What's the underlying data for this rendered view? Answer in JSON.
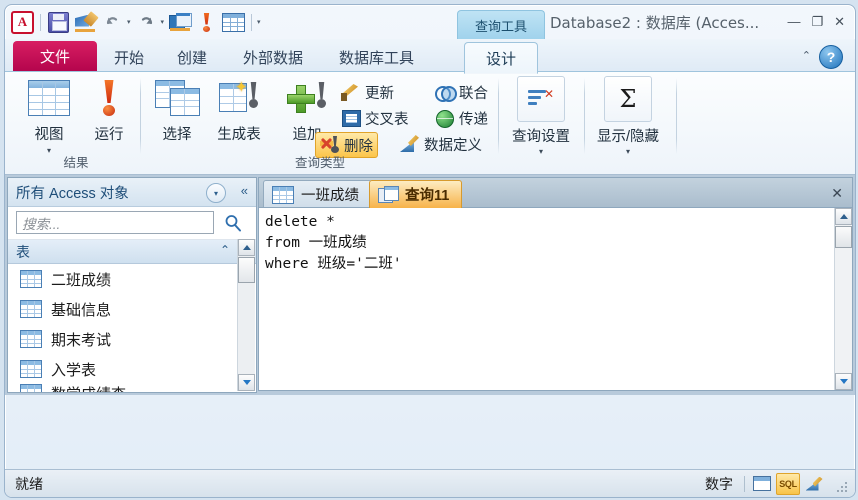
{
  "window": {
    "contextual_tab": "查询工具",
    "title": "Database2 : 数据库 (Acces...",
    "minimize": "—",
    "restore": "❐",
    "close": "✕"
  },
  "quick_access": {
    "logo": "A",
    "items": [
      {
        "name": "save-icon",
        "label": "保存"
      },
      {
        "name": "design-view-icon",
        "label": "设计视图"
      },
      {
        "name": "undo-icon",
        "label": "撤消"
      },
      {
        "name": "redo-icon",
        "label": "恢复"
      },
      {
        "name": "window-icon",
        "label": "窗口"
      },
      {
        "name": "run-icon",
        "label": "运行"
      },
      {
        "name": "datasheet-icon",
        "label": "数据表"
      }
    ],
    "overflow": "▾"
  },
  "ribbon": {
    "tabs": [
      {
        "label": "文件",
        "active": false,
        "file": true
      },
      {
        "label": "开始",
        "active": false
      },
      {
        "label": "创建",
        "active": false
      },
      {
        "label": "外部数据",
        "active": false
      },
      {
        "label": "数据库工具",
        "active": false
      },
      {
        "label": "设计",
        "active": true
      }
    ],
    "collapse_icon": "⌃",
    "help_icon": "?",
    "groups": [
      {
        "label": "结果",
        "big_buttons": [
          {
            "label": "视图",
            "icon": "table-view-icon",
            "dropdown": "▾"
          },
          {
            "label": "运行",
            "icon": "run-exclamation-icon",
            "dropdown": ""
          }
        ]
      },
      {
        "label": "查询类型",
        "big_buttons": [
          {
            "label": "选择",
            "icon": "select-query-icon",
            "dropdown": ""
          },
          {
            "label": "生成表",
            "icon": "make-table-query-icon",
            "dropdown": ""
          },
          {
            "label": "追加",
            "icon": "append-query-icon",
            "dropdown": ""
          }
        ],
        "small_buttons": [
          {
            "label": "更新",
            "icon": "update-query-icon",
            "selected": false
          },
          {
            "label": "联合",
            "icon": "union-query-icon",
            "selected": false
          },
          {
            "label": "交叉表",
            "icon": "crosstab-query-icon",
            "selected": false
          },
          {
            "label": "传递",
            "icon": "passthrough-query-icon",
            "selected": false
          },
          {
            "label": "删除",
            "icon": "delete-query-icon",
            "selected": true
          },
          {
            "label": "数据定义",
            "icon": "data-definition-icon",
            "selected": false
          }
        ]
      },
      {
        "label": "",
        "mid_buttons": [
          {
            "label": "查询设置",
            "icon": "query-setup-icon",
            "dropdown": "▾"
          },
          {
            "label": "显示/隐藏",
            "icon": "totals-sigma-icon",
            "dropdown": "▾"
          }
        ]
      }
    ]
  },
  "nav_pane": {
    "header": "所有 Access 对象",
    "header_dropdown": "▾",
    "collapse": "«",
    "search": {
      "value": "",
      "placeholder": "搜索..."
    },
    "group_header": "表",
    "group_chevron": "⌃",
    "items": [
      {
        "label": "二班成绩",
        "icon": "table-icon"
      },
      {
        "label": "基础信息",
        "icon": "table-icon"
      },
      {
        "label": "期末考试",
        "icon": "table-icon"
      },
      {
        "label": "入学表",
        "icon": "table-icon"
      },
      {
        "label": "数学成绩查",
        "icon": "table-icon"
      }
    ]
  },
  "document_tabs": [
    {
      "label": "一班成绩",
      "icon": "table-icon",
      "active": false
    },
    {
      "label": "查询11",
      "icon": "query-icon",
      "active": true
    }
  ],
  "document_close": "✕",
  "sql_editor": {
    "lines": [
      "delete *",
      "from 一班成绩",
      "where 班级='二班'"
    ],
    "text": "delete *\nfrom 一班成绩\nwhere 班级='二班'"
  },
  "status_bar": {
    "ready": "就绪",
    "num_lock": "数字",
    "view_buttons": [
      {
        "name": "datasheet-view-button",
        "label": "数据表视图",
        "active": false
      },
      {
        "name": "sql-view-button",
        "label": "SQL",
        "active": true
      },
      {
        "name": "design-view-button",
        "label": "设计视图",
        "active": false
      }
    ]
  },
  "colors": {
    "file_tab": "#c8105a",
    "selected_button": "#f8c349",
    "active_doc_tab": "#f7b34a",
    "contextual_tab": "#9fd2ec",
    "nav_header_text": "#1f4e79"
  }
}
